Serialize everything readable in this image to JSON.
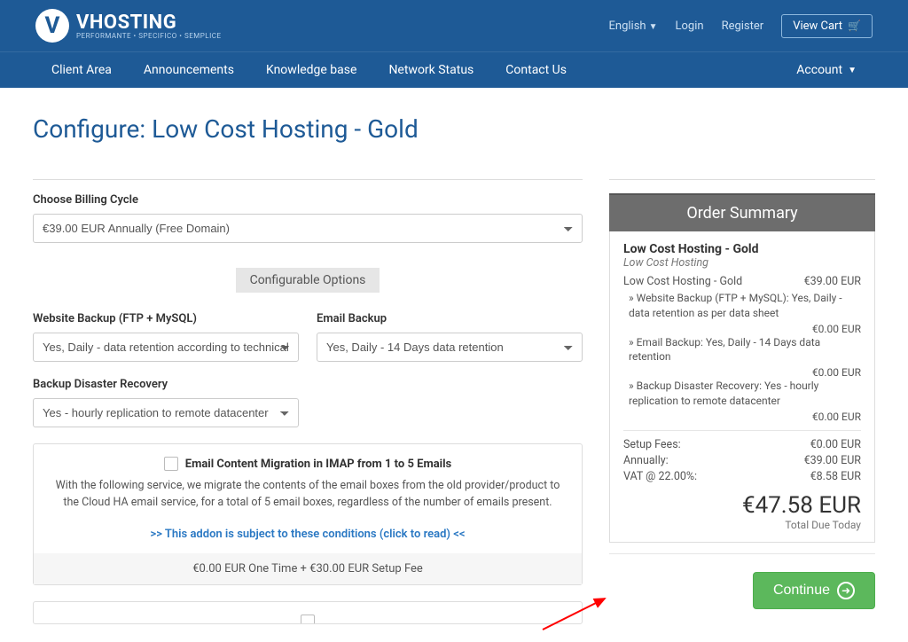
{
  "topbar": {
    "brand_main": "VHOSTING",
    "brand_sub": "PERFORMANTE • SPECIFICO • SEMPLICE",
    "language": "English",
    "login": "Login",
    "register": "Register",
    "viewcart": "View Cart"
  },
  "nav": {
    "items": [
      "Client Area",
      "Announcements",
      "Knowledge base",
      "Network Status",
      "Contact Us"
    ],
    "account": "Account"
  },
  "page": {
    "title": "Configure: Low Cost Hosting - Gold",
    "billing_label": "Choose Billing Cycle",
    "billing_value": "€39.00 EUR Annually (Free Domain)",
    "config_header": "Configurable Options",
    "opt1_label": "Website Backup (FTP + MySQL)",
    "opt1_value": "Yes, Daily - data retention according to technical sheet",
    "opt2_label": "Email Backup",
    "opt2_value": "Yes, Daily - 14 Days data retention",
    "opt3_label": "Backup Disaster Recovery",
    "opt3_value": "Yes - hourly replication to remote datacenter",
    "addon_title": "Email Content Migration in IMAP from 1 to 5 Emails",
    "addon_desc": "With the following service, we migrate the contents of the email boxes from the old provider/product to the Cloud HA email service, for a total of 5 email boxes, regardless of the number of emails present.",
    "addon_link": ">> This addon is subject to these conditions (click to read) <<",
    "addon_price": "€0.00 EUR One Time + €30.00 EUR Setup Fee"
  },
  "summary": {
    "header": "Order Summary",
    "product": "Low Cost Hosting - Gold",
    "category": "Low Cost Hosting",
    "line1_label": "Low Cost Hosting - Gold",
    "line1_price": "€39.00 EUR",
    "sub1": "» Website Backup (FTP + MySQL): Yes, Daily - data retention as per data sheet",
    "sub1_price": "€0.00 EUR",
    "sub2": "» Email Backup: Yes, Daily - 14 Days data retention",
    "sub2_price": "€0.00 EUR",
    "sub3": "» Backup Disaster Recovery: Yes - hourly replication to remote datacenter",
    "sub3_price": "€0.00 EUR",
    "setup_label": "Setup Fees:",
    "setup_price": "€0.00 EUR",
    "annual_label": "Annually:",
    "annual_price": "€39.00 EUR",
    "vat_label": "VAT @ 22.00%:",
    "vat_price": "€8.58 EUR",
    "total": "€47.58 EUR",
    "total_label": "Total Due Today",
    "continue": "Continue"
  }
}
